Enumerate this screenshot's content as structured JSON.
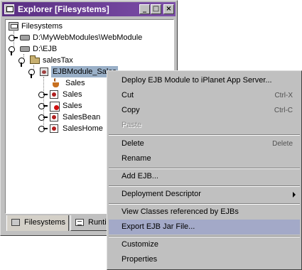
{
  "window": {
    "title": "Explorer [Filesystems]",
    "min_glyph": "_",
    "max_glyph": "□",
    "close_glyph": "×"
  },
  "tree": {
    "items": [
      {
        "label": "Filesystems",
        "icon": "filesystems-icon"
      },
      {
        "label": "D:\\MyWebModules\\WebModule",
        "icon": "drive-icon"
      },
      {
        "label": "D:\\EJB",
        "icon": "drive-icon"
      },
      {
        "label": "salesTax",
        "icon": "folder-icon"
      },
      {
        "label": "EJBModule_Sales",
        "icon": "ejb-module-icon",
        "selected": true
      },
      {
        "label": "Sales",
        "icon": "coffee-cup-icon"
      },
      {
        "label": "Sales",
        "icon": "bean-icon"
      },
      {
        "label": "Sales",
        "icon": "bean-error-icon"
      },
      {
        "label": "SalesBean",
        "icon": "bean-icon"
      },
      {
        "label": "SalesHome",
        "icon": "bean-icon"
      }
    ]
  },
  "tabs": [
    {
      "label": "Filesystems",
      "icon": "filesystems-icon",
      "active": true
    },
    {
      "label": "Runti",
      "icon": "runtime-icon",
      "active": false
    }
  ],
  "context_menu": {
    "items": [
      {
        "label": "Deploy EJB Module to iPlanet App Server...",
        "shortcut": ""
      },
      {
        "label": "Cut",
        "shortcut": "Ctrl-X"
      },
      {
        "label": "Copy",
        "shortcut": "Ctrl-C"
      },
      {
        "label": "Paste",
        "shortcut": "",
        "disabled": true
      },
      {
        "label": "Delete",
        "shortcut": "Delete"
      },
      {
        "label": "Rename",
        "shortcut": ""
      },
      {
        "label": "Add EJB...",
        "shortcut": ""
      },
      {
        "label": "Deployment Descriptor",
        "shortcut": "",
        "submenu": true
      },
      {
        "label": "View Classes referenced by EJBs",
        "shortcut": ""
      },
      {
        "label": "Export EJB Jar File...",
        "shortcut": "",
        "hover": true
      },
      {
        "label": "Customize",
        "shortcut": ""
      },
      {
        "label": "Properties",
        "shortcut": ""
      }
    ]
  },
  "colors": {
    "titlebar": "#5a2f82",
    "selection": "#9ab0c8",
    "menu_hover": "#a3a9c8",
    "chrome": "#c0c0c0"
  }
}
